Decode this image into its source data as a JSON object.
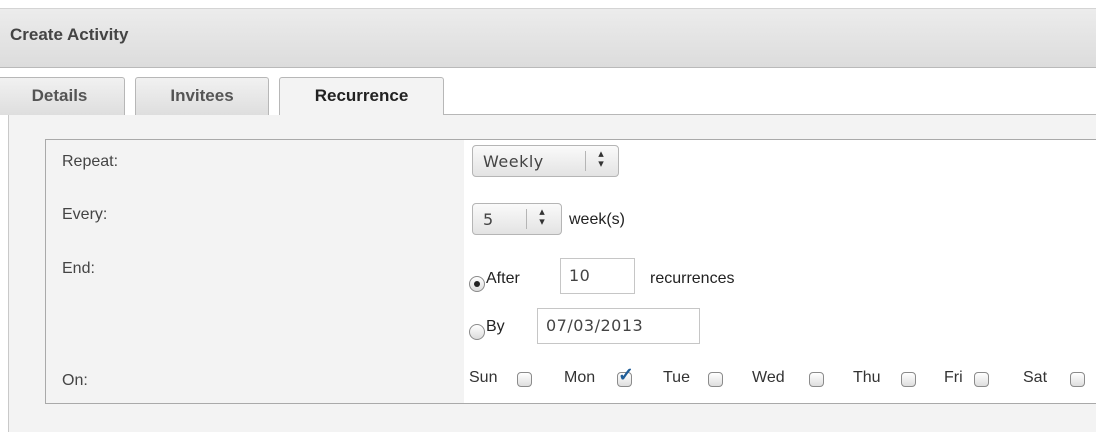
{
  "window": {
    "title": "Create Activity"
  },
  "tabs": [
    {
      "label": "Details",
      "active": false
    },
    {
      "label": "Invitees",
      "active": false
    },
    {
      "label": "Recurrence",
      "active": true
    }
  ],
  "form": {
    "repeat": {
      "label": "Repeat:",
      "selected": "Weekly"
    },
    "every": {
      "label": "Every:",
      "selected": "5",
      "unit": "week(s)"
    },
    "end": {
      "label": "End:",
      "after": {
        "label": "After",
        "value": "10",
        "suffix": "recurrences",
        "selected": true
      },
      "by": {
        "label": "By",
        "value": "07/03/2013",
        "selected": false
      }
    },
    "on": {
      "label": "On:",
      "days": [
        {
          "label": "Sun",
          "checked": false
        },
        {
          "label": "Mon",
          "checked": true
        },
        {
          "label": "Tue",
          "checked": false
        },
        {
          "label": "Wed",
          "checked": false
        },
        {
          "label": "Thu",
          "checked": false
        },
        {
          "label": "Fri",
          "checked": false
        },
        {
          "label": "Sat",
          "checked": false
        }
      ]
    }
  },
  "icons": {
    "select_arrows": "up-down-arrows-icon",
    "checkmark": "checkmark-icon"
  },
  "colors": {
    "checkmark": "#1f5d98",
    "panel_bg": "#f3f3f3",
    "tab_border": "#b7b7b7"
  }
}
